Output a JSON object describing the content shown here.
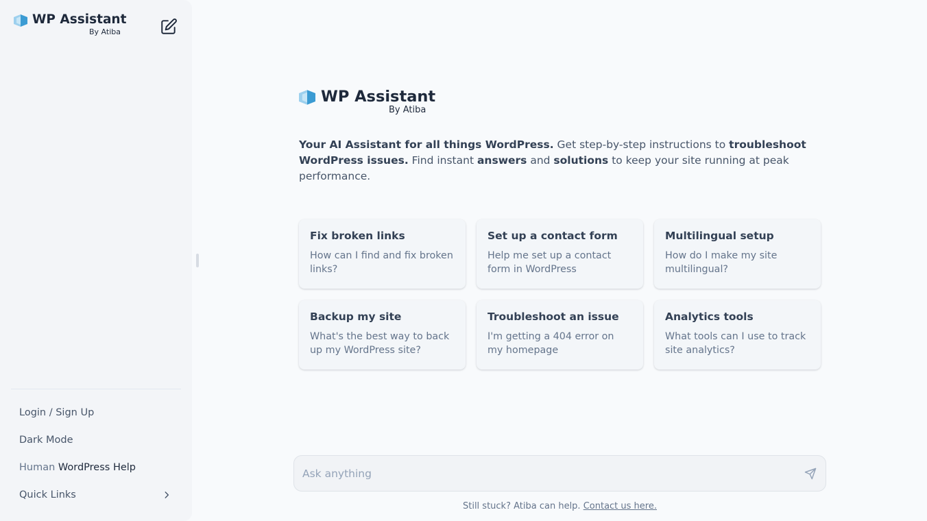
{
  "sidebar": {
    "brand": {
      "name": "WP Assistant",
      "by": "By Atiba"
    },
    "items": {
      "login": "Login / Sign Up",
      "dark_mode": "Dark Mode",
      "human_help_prefix": "Human",
      "human_help_main": "WordPress Help",
      "quick_links": "Quick Links"
    }
  },
  "hero": {
    "name": "WP Assistant",
    "by": "By Atiba",
    "intro": {
      "b1": "Your AI Assistant for all things WordPress.",
      "t1": " Get step-by-step instructions to ",
      "b2": "troubleshoot WordPress issues.",
      "t2": " Find instant ",
      "b3": "answers",
      "t3": " and ",
      "b4": "solutions",
      "t4": " to keep your site running at peak performance."
    }
  },
  "cards": [
    {
      "title": "Fix broken links",
      "desc": "How can I find and fix broken links?"
    },
    {
      "title": "Set up a contact form",
      "desc": "Help me set up a contact form in WordPress"
    },
    {
      "title": "Multilingual setup",
      "desc": "How do I make my site multilingual?"
    },
    {
      "title": "Backup my site",
      "desc": "What's the best way to back up my WordPress site?"
    },
    {
      "title": "Troubleshoot an issue",
      "desc": "I'm getting a 404 error on my homepage"
    },
    {
      "title": "Analytics tools",
      "desc": "What tools can I use to track site analytics?"
    }
  ],
  "composer": {
    "placeholder": "Ask anything",
    "value": ""
  },
  "footer": {
    "text": "Still stuck? Atiba can help.",
    "link": "Contact us here."
  },
  "colors": {
    "accent": "#1e293b",
    "logo_light": "#9dd0ee",
    "logo_dark": "#3b9bd3"
  }
}
